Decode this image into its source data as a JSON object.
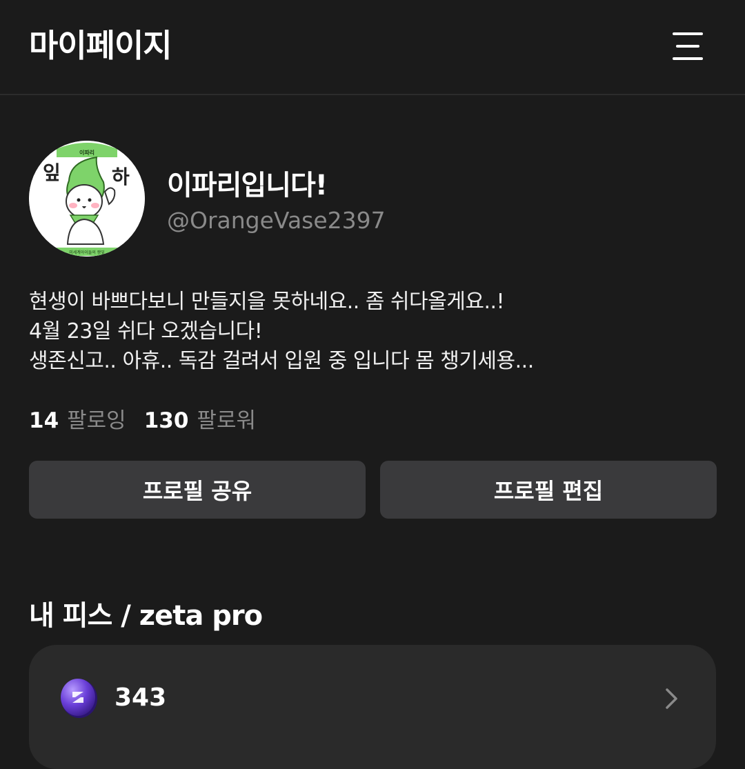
{
  "header": {
    "title": "마이페이지",
    "menu_icon": "hamburger-menu-icon"
  },
  "profile": {
    "display_name": "이파리입니다!",
    "handle": "@OrangeVase2397",
    "avatar": {
      "top_text": "이파리",
      "left_char": "잎",
      "right_char": "하",
      "bottom_text": "미세계아이들의 짱잎",
      "accent_color": "#7ed36a"
    },
    "bio_lines": [
      "현생이 바쁘다보니 만들지을 못하네요.. 좀 쉬다올게요..!",
      "4월 23일 쉬다 오겠습니다!",
      "생존신고.. 아휴.. 독감 걸려서 입원 중 입니다 몸 챙기세용..."
    ],
    "following_count": "14",
    "following_label": "팔로잉",
    "followers_count": "130",
    "followers_label": "팔로워"
  },
  "actions": {
    "share_label": "프로필 공유",
    "edit_label": "프로필 편집"
  },
  "pieces": {
    "section_title": "내 피스 / zeta pro",
    "balance": "343",
    "coin_icon": "piece-coin-icon",
    "chevron_icon": "chevron-right-icon"
  },
  "colors": {
    "background": "#1b1b1b",
    "button": "#3a3a3c",
    "card": "#2a2a2a",
    "muted_text": "#8a8a8a",
    "coin_purple": "#6a3fd8"
  }
}
